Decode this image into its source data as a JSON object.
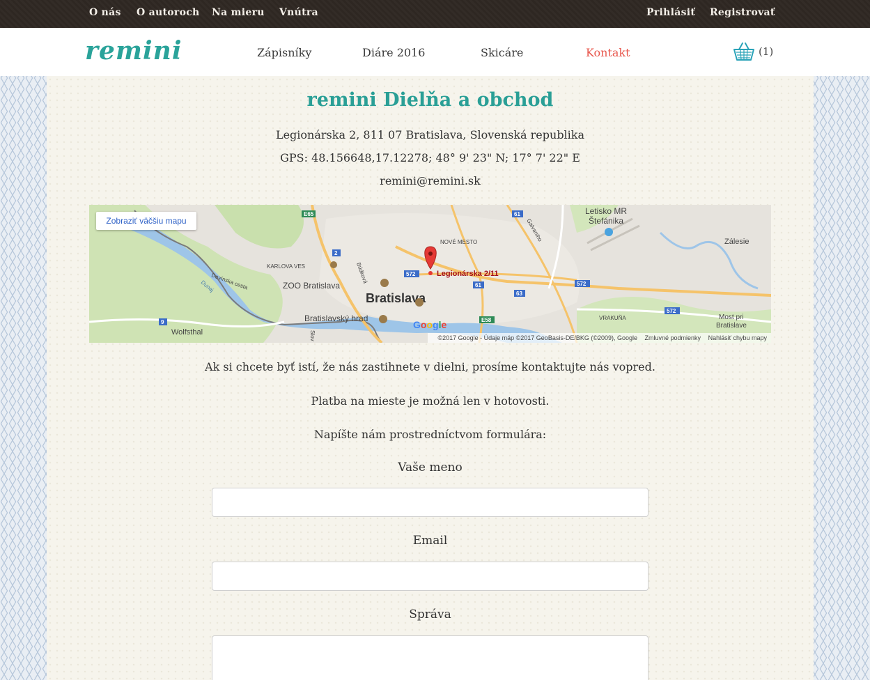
{
  "topbar": {
    "left": [
      "O nás",
      "O autoroch",
      "Na mieru",
      "Vnútra"
    ],
    "login": "Prihlásiť",
    "register": "Registrovať"
  },
  "header": {
    "logo": "remini",
    "nav": [
      "Zápisníky",
      "Diáre 2016",
      "Skicáre",
      "Kontakt"
    ],
    "active_nav": "Kontakt",
    "cart_count": "(1)"
  },
  "contact": {
    "title": "remini Dielňa a obchod",
    "address": "Legionárska 2, 811 07 Bratislava, Slovenská republika",
    "gps": "GPS: 48.156648,17.12278; 48° 9' 23\" N; 17° 7' 22\" E",
    "email": "remini@remini.sk"
  },
  "map": {
    "bigger_map_button": "Zobraziť väčšiu mapu",
    "marker_label": "Legionárska 2/11",
    "places": {
      "airport": "Letisko MR",
      "airport2": "Štefánika",
      "zalesie": "Zálesie",
      "nove_mesto": "NOVÉ MESTO",
      "karlova_ves": "KARLOVA VES",
      "zoo": "ZOO Bratislava",
      "city": "Bratislava",
      "castle": "Bratislavský hrad",
      "wolfsthal": "Wolfsthal",
      "vrakuna": "VRAKUŇA",
      "most": "Most pri",
      "most2": "Bratislave",
      "devinska": "Devínska cesta",
      "galvaniho": "Galvaniho",
      "dunaj": "Dunaj",
      "budkova": "Búdková",
      "slov": "Slov"
    },
    "roads": [
      "E65",
      "61",
      "2",
      "572",
      "61",
      "63",
      "572",
      "572",
      "9",
      "E58"
    ],
    "google": "Google",
    "attribution": "©2017 Google - Údaje máp ©2017 GeoBasis-DE/BKG (©2009), Google",
    "terms": "Zmluvné podmienky",
    "report": "Nahlásiť chybu mapy"
  },
  "notes": {
    "visit": "Ak si chcete byť istí, že nás zastihnete v dielni, prosíme kontaktujte nás vopred.",
    "payment": "Platba na mieste je možná len v hotovosti.",
    "form_intro": "Napíšte nám prostredníctvom formulára:"
  },
  "form": {
    "name_label": "Vaše meno",
    "email_label": "Email",
    "message_label": "Správa"
  },
  "colors": {
    "accent": "#2aa39a",
    "active_nav": "#e8584e",
    "topbar": "#2e2722"
  }
}
